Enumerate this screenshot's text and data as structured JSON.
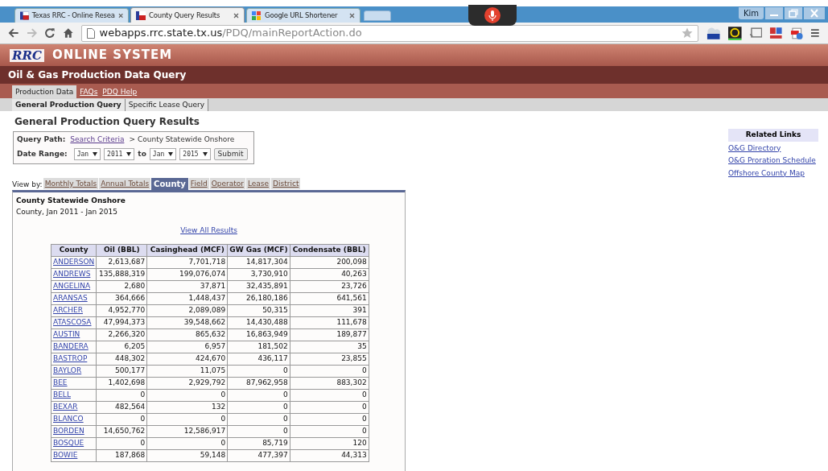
{
  "browser": {
    "tabs": [
      {
        "title": "Texas RRC - Online Resea",
        "selected": false
      },
      {
        "title": "County Query Results",
        "selected": true
      },
      {
        "title": "Google URL Shortener",
        "selected": false
      }
    ],
    "profile": "Kim",
    "url_host": "webapps.rrc.state.tx.us",
    "url_path": "/PDQ/mainReportAction.do"
  },
  "header": {
    "logo": "RRC",
    "title": "ONLINE SYSTEM",
    "subtitle": "Oil & Gas Production Data Query"
  },
  "nav": [
    {
      "label": "Production Data",
      "selected": true
    },
    {
      "label": "FAQs",
      "selected": false
    },
    {
      "label": "PDQ Help",
      "selected": false
    }
  ],
  "subnav": [
    {
      "label": "General Production Query",
      "selected": true
    },
    {
      "label": "Specific Lease Query",
      "selected": false
    }
  ],
  "page_title": "General Production Query Results",
  "query": {
    "path_label": "Query Path:",
    "path_link": "Search Criteria",
    "path_separator": ">",
    "path_current": "County Statewide Onshore",
    "date_label": "Date Range:",
    "from_month": "Jan",
    "from_year": "2011",
    "to_label": "to",
    "to_month": "Jan",
    "to_year": "2015",
    "submit": "Submit"
  },
  "related_links": {
    "title": "Related Links",
    "links": [
      "O&G Directory",
      "O&G Proration Schedule",
      "Offshore County Map"
    ]
  },
  "view_by": {
    "label": "View by:",
    "tabs": [
      {
        "label": "Monthly Totals",
        "selected": false
      },
      {
        "label": "Annual Totals",
        "selected": false
      },
      {
        "label": "County",
        "selected": true
      },
      {
        "label": "Field",
        "selected": false
      },
      {
        "label": "Operator",
        "selected": false
      },
      {
        "label": "Lease",
        "selected": false
      },
      {
        "label": "District",
        "selected": false
      }
    ]
  },
  "results": {
    "title": "County Statewide Onshore",
    "subtitle": "County, Jan 2011 - Jan 2015",
    "view_all": "View All Results",
    "columns": [
      "County",
      "Oil (BBL)",
      "Casinghead (MCF)",
      "GW Gas (MCF)",
      "Condensate (BBL)"
    ],
    "rows": [
      [
        "ANDERSON",
        "2,613,687",
        "7,701,718",
        "14,817,304",
        "200,098"
      ],
      [
        "ANDREWS",
        "135,888,319",
        "199,076,074",
        "3,730,910",
        "40,263"
      ],
      [
        "ANGELINA",
        "2,680",
        "37,871",
        "32,435,891",
        "23,726"
      ],
      [
        "ARANSAS",
        "364,666",
        "1,448,437",
        "26,180,186",
        "641,561"
      ],
      [
        "ARCHER",
        "4,952,770",
        "2,089,089",
        "50,315",
        "391"
      ],
      [
        "ATASCOSA",
        "47,994,373",
        "39,548,662",
        "14,430,488",
        "111,678"
      ],
      [
        "AUSTIN",
        "2,266,320",
        "865,632",
        "16,863,949",
        "189,877"
      ],
      [
        "BANDERA",
        "6,205",
        "6,957",
        "181,502",
        "35"
      ],
      [
        "BASTROP",
        "448,302",
        "424,670",
        "436,117",
        "23,855"
      ],
      [
        "BAYLOR",
        "500,177",
        "11,075",
        "0",
        "0"
      ],
      [
        "BEE",
        "1,402,698",
        "2,929,792",
        "87,962,958",
        "883,302"
      ],
      [
        "BELL",
        "0",
        "0",
        "0",
        "0"
      ],
      [
        "BEXAR",
        "482,564",
        "132",
        "0",
        "0"
      ],
      [
        "BLANCO",
        "0",
        "0",
        "0",
        "0"
      ],
      [
        "BORDEN",
        "14,650,762",
        "12,586,917",
        "0",
        "0"
      ],
      [
        "BOSQUE",
        "0",
        "0",
        "85,719",
        "120"
      ],
      [
        "BOWIE",
        "187,868",
        "59,148",
        "477,397",
        "44,313"
      ]
    ]
  }
}
